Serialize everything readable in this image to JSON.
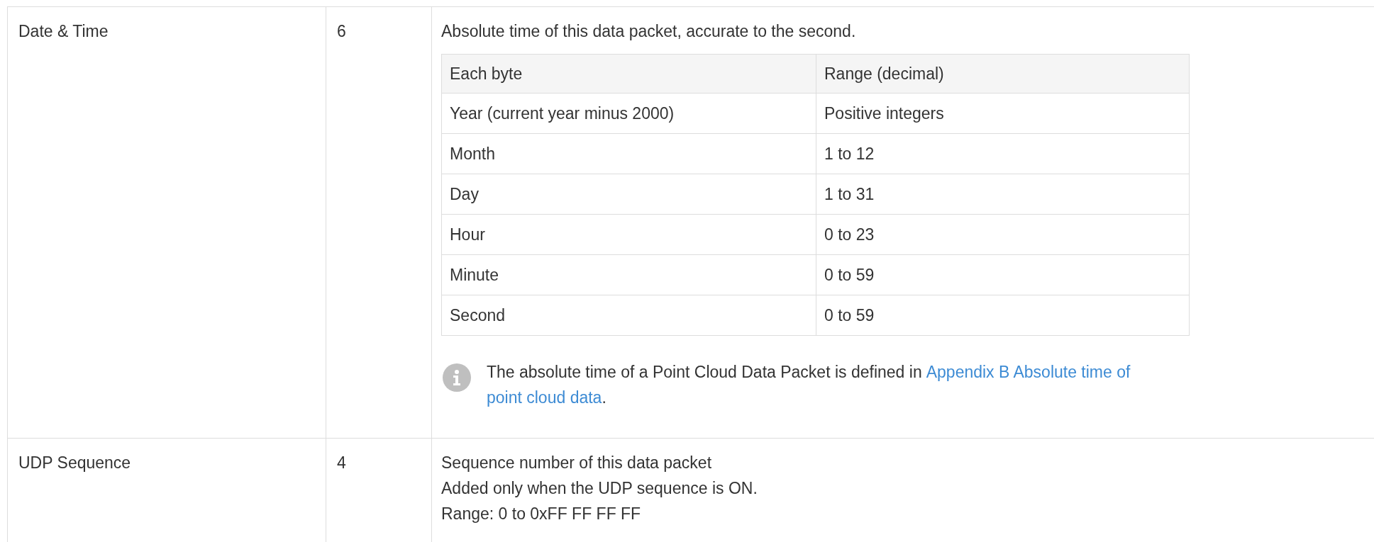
{
  "rows": [
    {
      "field": "Date & Time",
      "size": "6",
      "description": [
        "Absolute time of this data packet, accurate to the second."
      ],
      "subtable": {
        "columns": [
          "Each byte",
          "Range (decimal)"
        ],
        "rows": [
          [
            "Year (current year minus 2000)",
            "Positive integers"
          ],
          [
            "Month",
            "1 to 12"
          ],
          [
            "Day",
            "1 to 31"
          ],
          [
            "Hour",
            "0 to 23"
          ],
          [
            "Minute",
            "0 to 59"
          ],
          [
            "Second",
            "0 to 59"
          ]
        ]
      },
      "note": {
        "text": "The absolute time of a Point Cloud Data Packet is defined in",
        "link": [
          "Appendix B Absolute time of",
          "point cloud data"
        ],
        "after": "."
      }
    },
    {
      "field": "UDP Sequence",
      "size": "4",
      "description": [
        "Sequence number of this data packet",
        "Added only when the UDP sequence is ON.",
        "Range: 0 to 0xFF FF FF FF"
      ]
    }
  ]
}
